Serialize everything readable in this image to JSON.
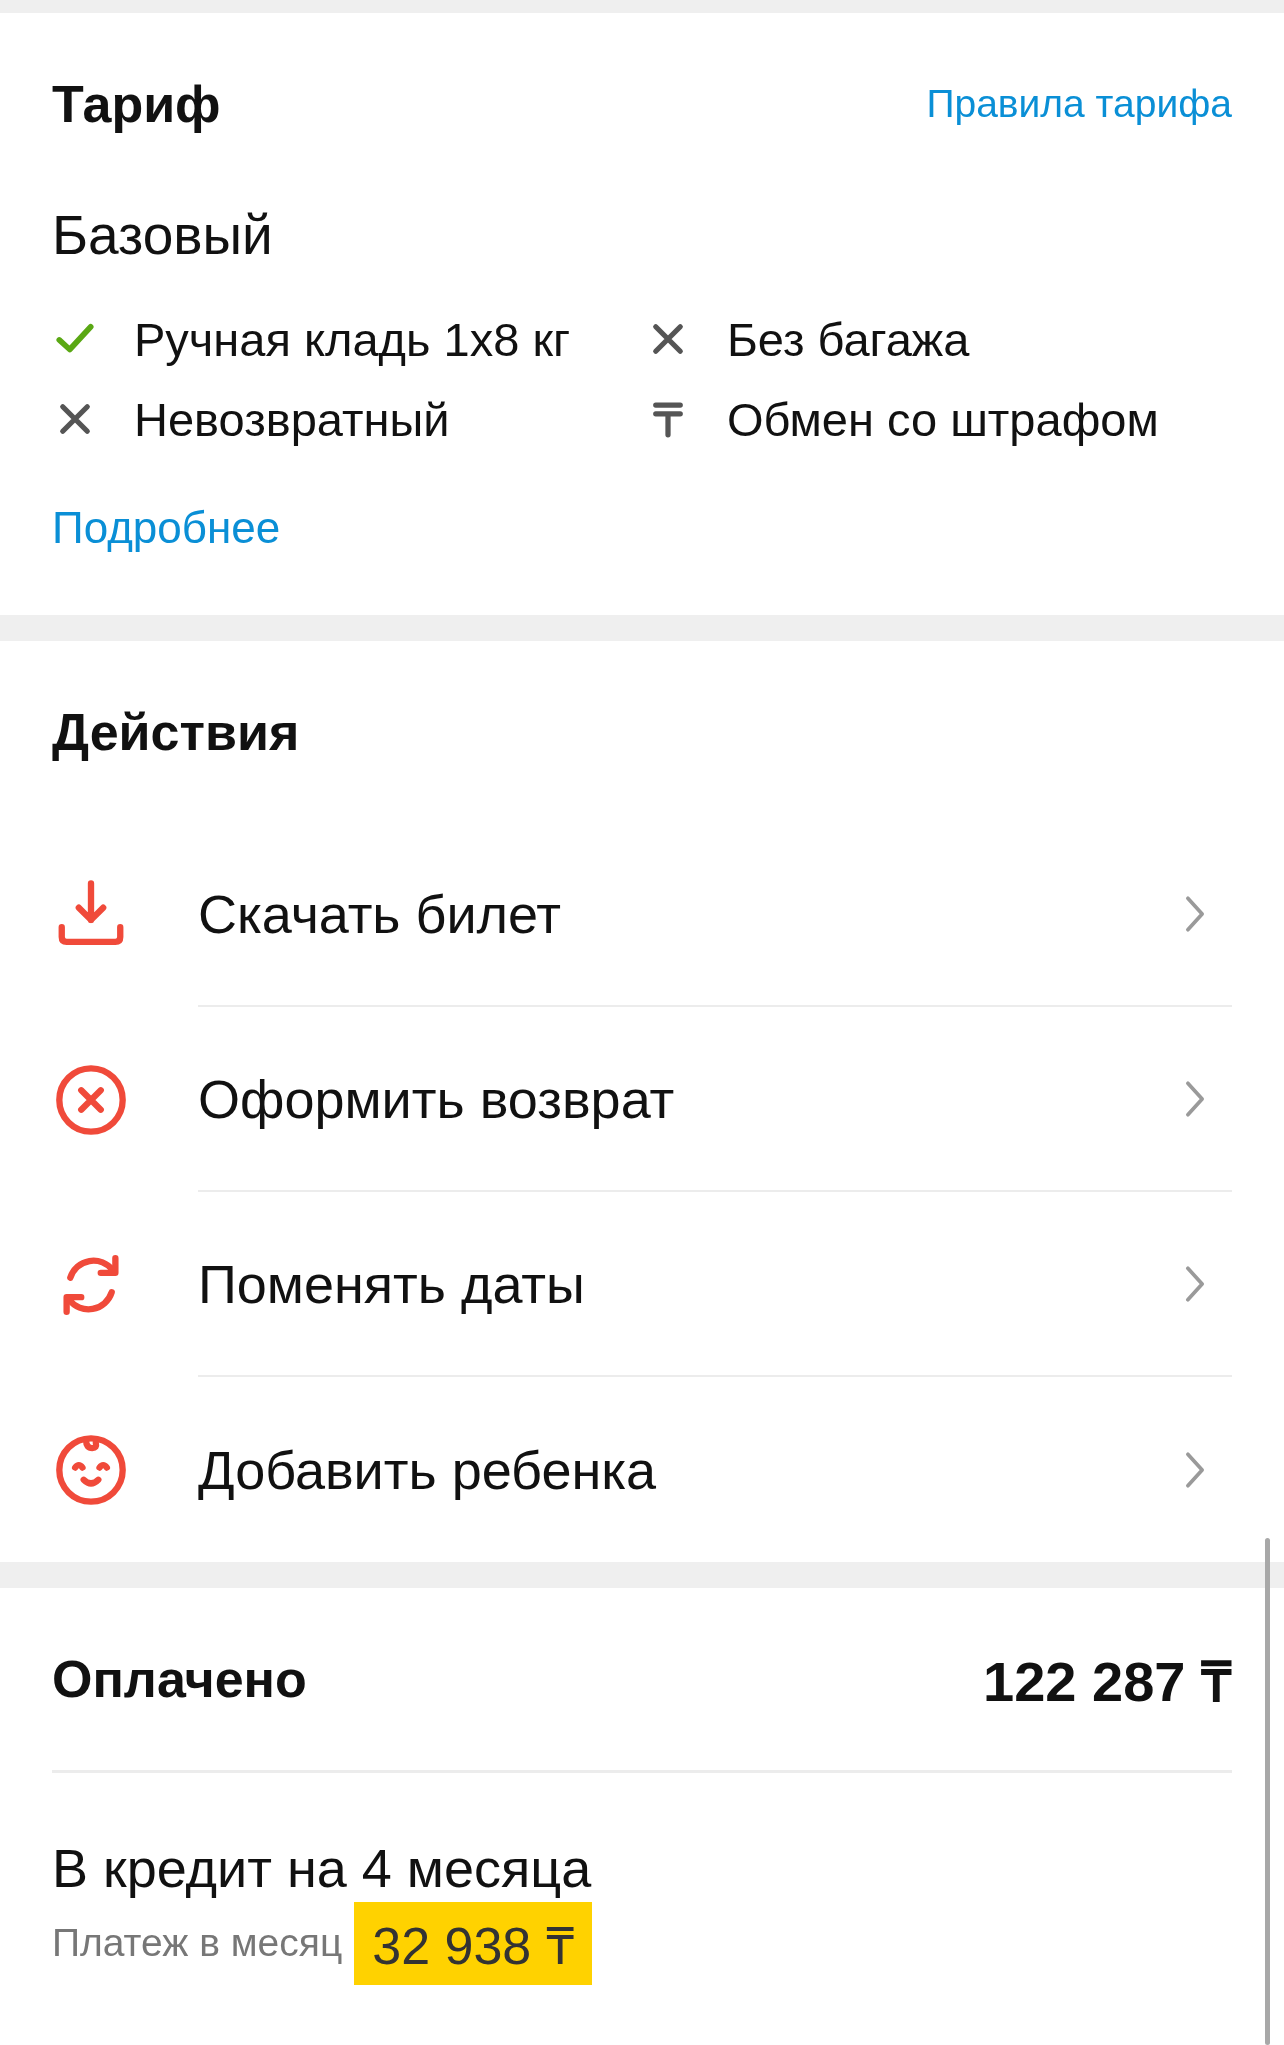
{
  "tariff": {
    "title": "Тариф",
    "rules_link": "Правила тарифа",
    "name": "Базовый",
    "features": [
      {
        "kind": "included",
        "text": "Ручная кладь 1x8 кг"
      },
      {
        "kind": "excluded",
        "text": "Без багажа"
      },
      {
        "kind": "excluded",
        "text": "Невозвратный"
      },
      {
        "kind": "fee",
        "text": "Обмен со штрафом"
      }
    ],
    "details_link": "Подробнее"
  },
  "actions": {
    "title": "Действия",
    "items": [
      {
        "kind": "download",
        "label": "Скачать билет"
      },
      {
        "kind": "refund",
        "label": "Оформить возврат"
      },
      {
        "kind": "change",
        "label": "Поменять даты"
      },
      {
        "kind": "child",
        "label": "Добавить ребенка"
      }
    ]
  },
  "payment": {
    "title": "Оплачено",
    "amount": "122 287 ₸",
    "credit_title": "В кредит на 4 месяца",
    "monthly_label": "Платеж в месяц",
    "monthly_amount": "32 938 ₸"
  }
}
